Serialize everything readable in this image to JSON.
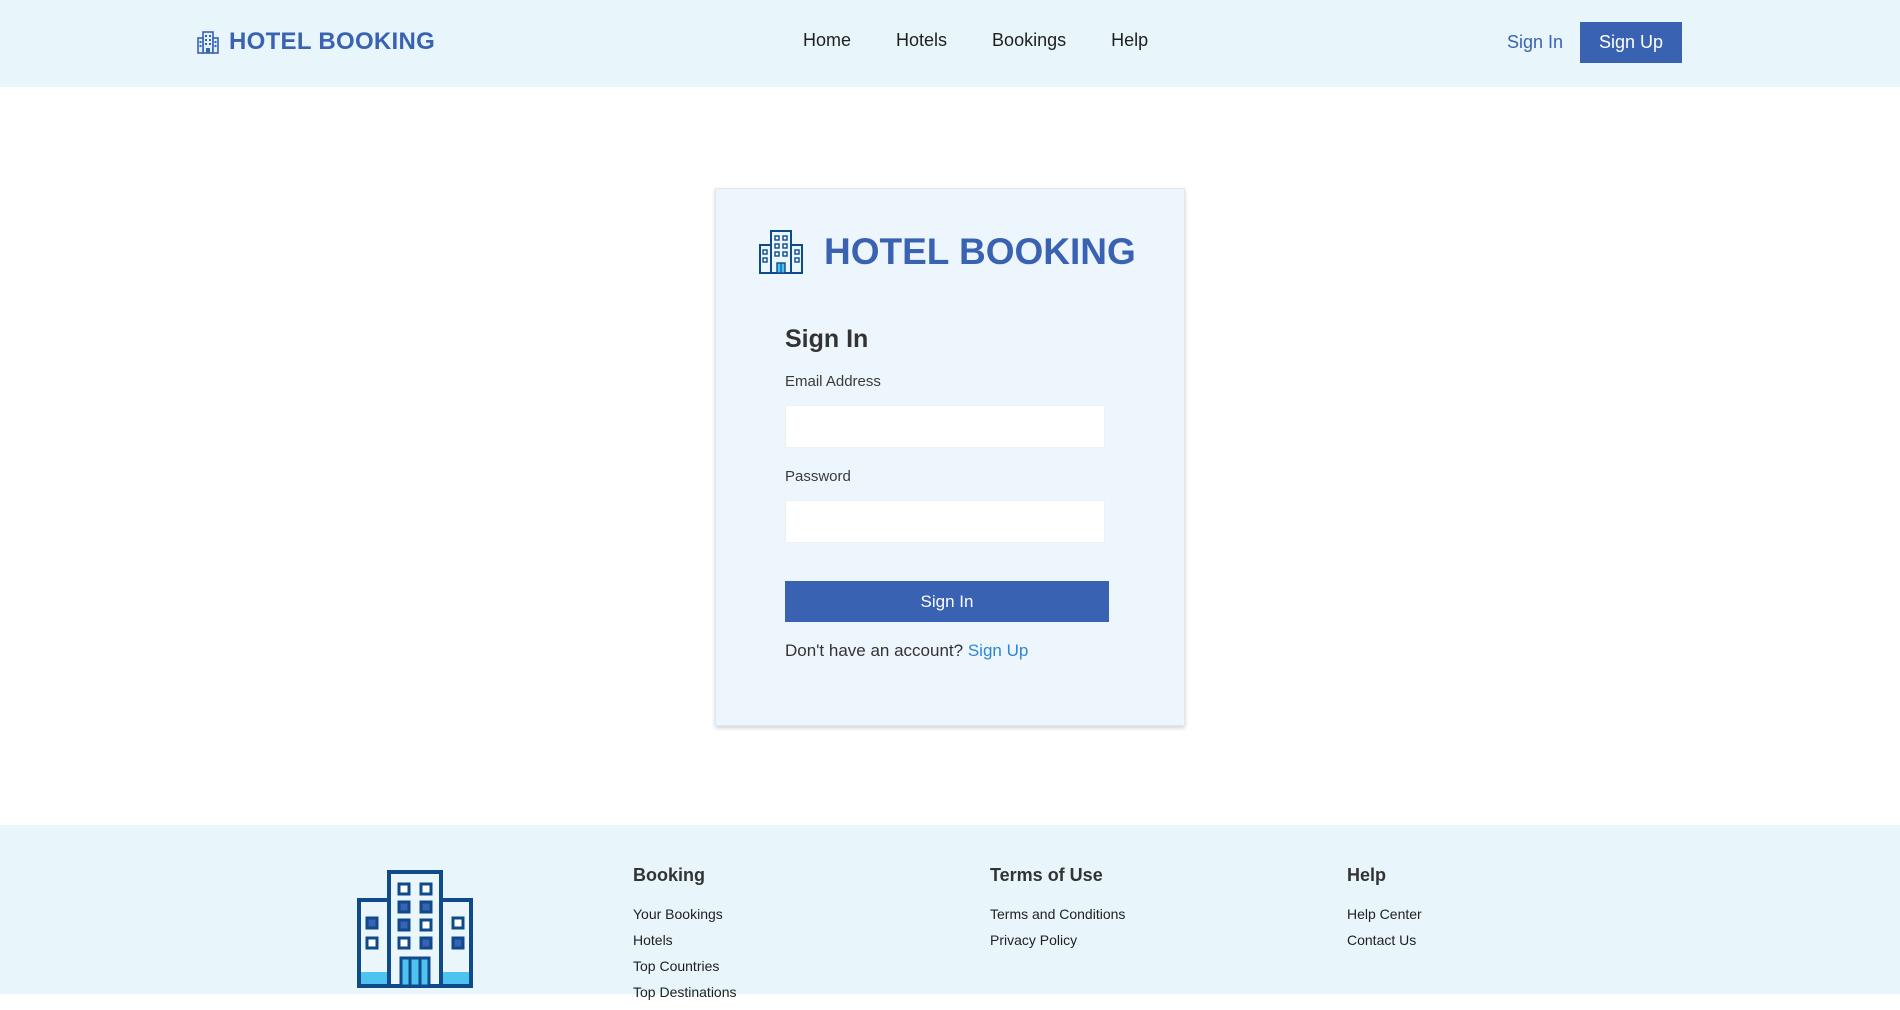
{
  "header": {
    "brand": "HOTEL BOOKING",
    "nav": [
      "Home",
      "Hotels",
      "Bookings",
      "Help"
    ],
    "sign_in": "Sign In",
    "sign_up": "Sign Up"
  },
  "card": {
    "brand": "HOTEL BOOKING",
    "title": "Sign In",
    "email_label": "Email Address",
    "email_value": "",
    "password_label": "Password",
    "password_value": "",
    "submit_label": "Sign In",
    "account_prompt": "Don't have an account?",
    "signup_link": "Sign Up"
  },
  "footer": {
    "columns": [
      {
        "title": "Booking",
        "items": [
          "Your Bookings",
          "Hotels",
          "Top Countries",
          "Top Destinations"
        ]
      },
      {
        "title": "Terms of Use",
        "items": [
          "Terms and Conditions",
          "Privacy Policy"
        ]
      },
      {
        "title": "Help",
        "items": [
          "Help Center",
          "Contact Us"
        ]
      }
    ]
  },
  "colors": {
    "brand": "#3a62b2",
    "header_bg": "#e8f6fc",
    "card_bg": "#eef6fd",
    "link": "#2b86d6"
  },
  "icons": {
    "brand_logo": "hotel-building-icon"
  }
}
